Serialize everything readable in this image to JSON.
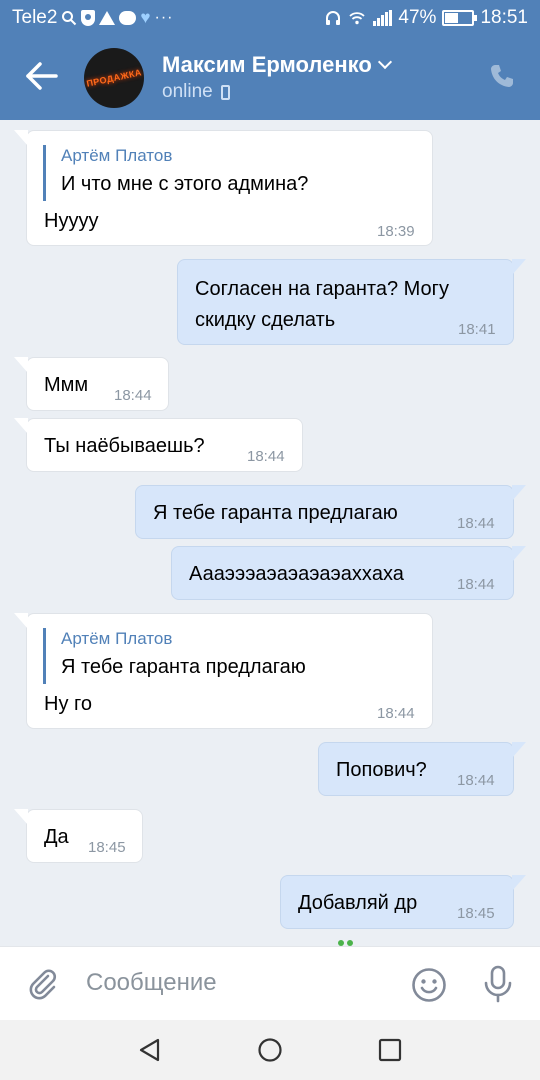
{
  "status_bar": {
    "carrier": "Tele2",
    "battery": "47%",
    "time": "18:51"
  },
  "header": {
    "contact_name": "Максим Ермоленко",
    "status": "online",
    "avatar_text": "ПРОДАЖКА"
  },
  "messages": [
    {
      "direction": "in",
      "reply_author": "Артём Платов",
      "reply_text": "И что мне с этого админа?",
      "text": "Нуууу",
      "time": "18:39"
    },
    {
      "direction": "out",
      "lines": [
        "Согласен на гаранта? Могу",
        "скидку сделать"
      ],
      "time": "18:41"
    },
    {
      "direction": "in",
      "text": "Ммм",
      "time": "18:44"
    },
    {
      "direction": "in",
      "text": "Ты наёбываешь?",
      "time": "18:44"
    },
    {
      "direction": "out",
      "text": "Я тебе гаранта предлагаю",
      "time": "18:44"
    },
    {
      "direction": "out",
      "text": "Аааэээаэаэаэаэахxаха",
      "time": "18:44"
    },
    {
      "direction": "in",
      "reply_author": "Артём Платов",
      "reply_text": "Я тебе гаранта предлагаю",
      "text": "Ну го",
      "time": "18:44"
    },
    {
      "direction": "out",
      "text": "Попович?",
      "time": "18:44"
    },
    {
      "direction": "in",
      "text": "Да",
      "time": "18:45"
    },
    {
      "direction": "out",
      "text": "Добавляй др",
      "time": "18:45"
    }
  ],
  "composer": {
    "placeholder": "Сообщение"
  },
  "colors": {
    "header": "#5181b8",
    "outgoing_bubble": "#d7e6fa",
    "incoming_bubble": "#ffffff",
    "background": "#ebeff4"
  }
}
